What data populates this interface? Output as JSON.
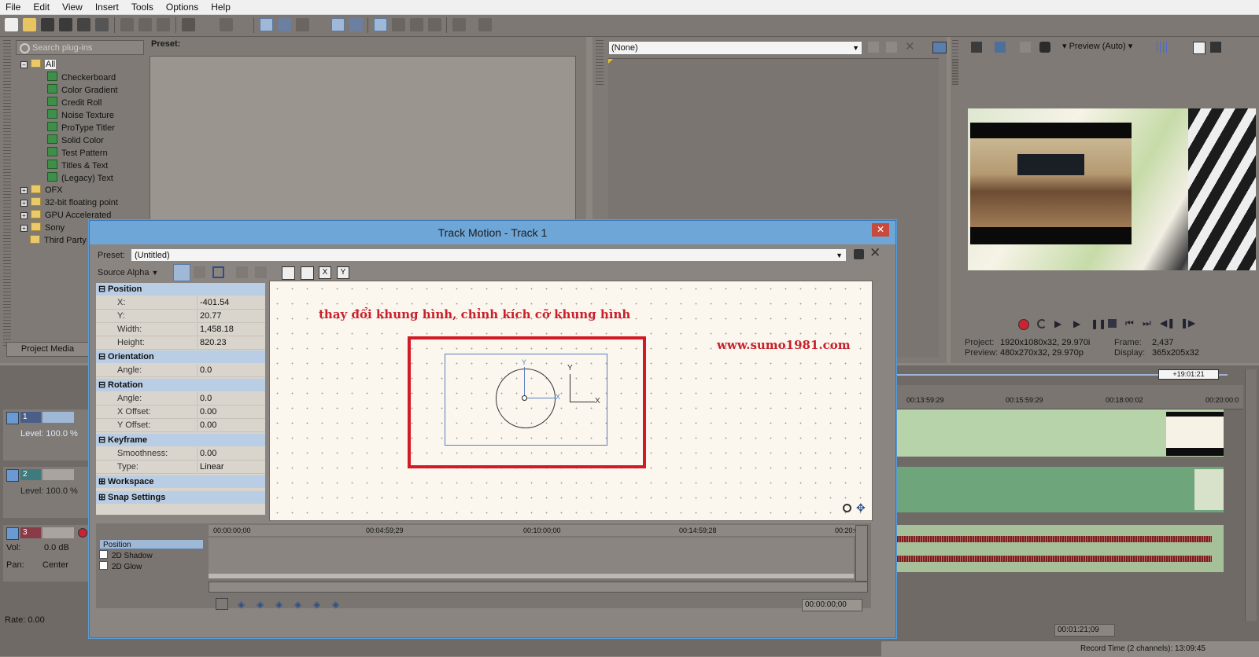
{
  "menu": [
    "File",
    "Edit",
    "View",
    "Insert",
    "Tools",
    "Options",
    "Help"
  ],
  "plugins": {
    "search_placeholder": "Search plug-ins",
    "preset_label": "Preset:",
    "tree": [
      {
        "label": "All",
        "type": "folder",
        "level": 0,
        "selected": true
      },
      {
        "label": "Checkerboard",
        "type": "fx",
        "level": 1
      },
      {
        "label": "Color Gradient",
        "type": "fx",
        "level": 1
      },
      {
        "label": "Credit Roll",
        "type": "fx",
        "level": 1
      },
      {
        "label": "Noise Texture",
        "type": "fx",
        "level": 1
      },
      {
        "label": "ProType Titler",
        "type": "fx",
        "level": 1
      },
      {
        "label": "Solid Color",
        "type": "fx",
        "level": 1
      },
      {
        "label": "Test Pattern",
        "type": "fx",
        "level": 1
      },
      {
        "label": "Titles & Text",
        "type": "fx",
        "level": 1
      },
      {
        "label": "(Legacy) Text",
        "type": "fx",
        "level": 1
      },
      {
        "label": "OFX",
        "type": "folder",
        "level": 0,
        "expandable": true
      },
      {
        "label": "32-bit floating point",
        "type": "folder",
        "level": 0,
        "expandable": true
      },
      {
        "label": "GPU Accelerated",
        "type": "folder",
        "level": 0,
        "expandable": true
      },
      {
        "label": "Sony",
        "type": "folder",
        "level": 0,
        "expandable": true
      },
      {
        "label": "Third Party",
        "type": "folder",
        "level": 0
      }
    ],
    "tab": "Project Media"
  },
  "fx_preset": {
    "value": "(None)"
  },
  "preview": {
    "mode_label": "Preview (Auto)",
    "project_label": "Project:",
    "project_value": "1920x1080x32, 29.970i",
    "preview_label": "Preview:",
    "preview_value": "480x270x32, 29.970p",
    "frame_label": "Frame:",
    "frame_value": "2,437",
    "display_label": "Display:",
    "display_value": "365x205x32"
  },
  "timeline": {
    "offset_badge": "+19:01:21",
    "ruler": [
      "00:13:59:29",
      "00:15:59:29",
      "00:18:00:02",
      "00:20:00:0"
    ],
    "tracks": [
      {
        "number": "1",
        "level_label": "Level: 100.0 %"
      },
      {
        "number": "2",
        "level_label": "Level: 100.0 %"
      },
      {
        "number": "3",
        "vol_label": "Vol:",
        "vol_value": "0.0 dB",
        "pan_label": "Pan:",
        "pan_value": "Center"
      }
    ],
    "rate_label": "Rate: 0.00",
    "cursor_time": "00:01:21;09",
    "record_time": "Record Time (2 channels): 13:09:45"
  },
  "dialog": {
    "title": "Track Motion - Track 1",
    "preset_label": "Preset:",
    "preset_value": "(Untitled)",
    "source_alpha": "Source Alpha",
    "sections": {
      "position": {
        "title": "Position",
        "rows": [
          [
            "X:",
            "-401.54"
          ],
          [
            "Y:",
            "20.77"
          ],
          [
            "Width:",
            "1,458.18"
          ],
          [
            "Height:",
            "820.23"
          ]
        ]
      },
      "orientation": {
        "title": "Orientation",
        "rows": [
          [
            "Angle:",
            "0.0"
          ]
        ]
      },
      "rotation": {
        "title": "Rotation",
        "rows": [
          [
            "Angle:",
            "0.0"
          ],
          [
            "X Offset:",
            "0.00"
          ],
          [
            "Y Offset:",
            "0.00"
          ]
        ]
      },
      "keyframe": {
        "title": "Keyframe",
        "rows": [
          [
            "Smoothness:",
            "0.00"
          ],
          [
            "Type:",
            "Linear"
          ]
        ]
      },
      "workspace": {
        "title": "Workspace"
      },
      "snap": {
        "title": "Snap Settings"
      }
    },
    "canvas_note": "thay đổi khung hình, chỉnh kích cỡ khung hình",
    "canvas_url": "www.sumo1981.com",
    "axis_y": "Y",
    "axis_x": "X",
    "kf_ruler": [
      "00:00:00;00",
      "00:04:59;29",
      "00:10:00;00",
      "00:14:59;28",
      "00:20:0"
    ],
    "kf_tracks": [
      "Position",
      "2D Shadow",
      "2D Glow"
    ],
    "time_value": "00:00:00;00"
  }
}
